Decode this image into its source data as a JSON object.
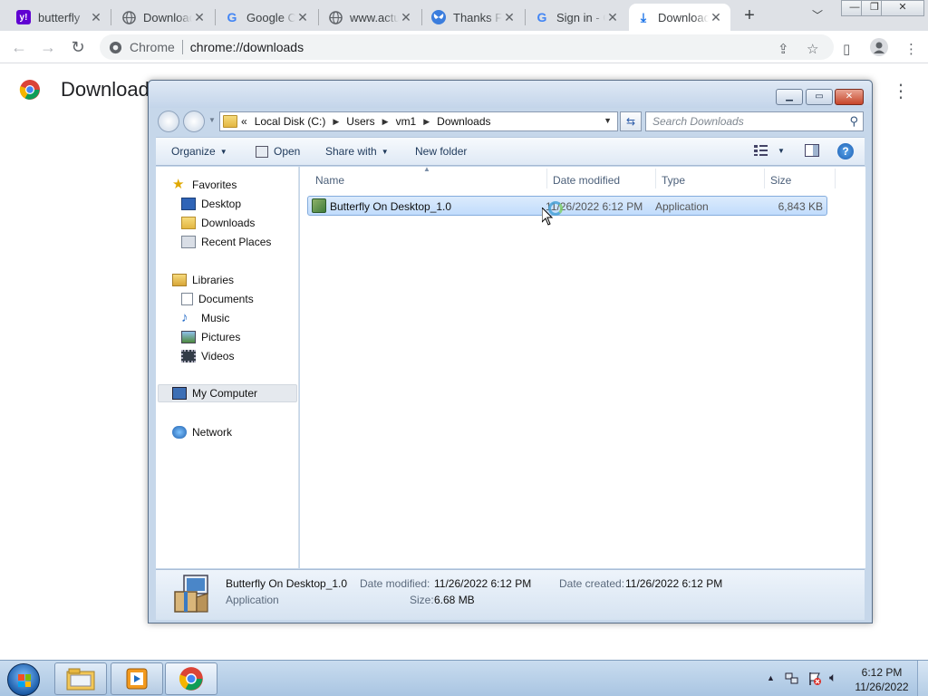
{
  "browser": {
    "tabs": [
      {
        "label": "butterfly",
        "favicon": "yahoo-icon",
        "active": false
      },
      {
        "label": "Downloads",
        "favicon": "globe-icon",
        "active": false
      },
      {
        "label": "Google Chrome",
        "favicon": "google-icon",
        "active": false
      },
      {
        "label": "www.actualsolution",
        "favicon": "globe-icon",
        "active": false
      },
      {
        "label": "Thanks For Downloading",
        "favicon": "butterfly-icon",
        "active": false
      },
      {
        "label": "Sign in - Google",
        "favicon": "google-icon",
        "active": false
      },
      {
        "label": "Downloads",
        "favicon": "download-icon",
        "active": true
      }
    ],
    "window_controls": {
      "minimize": "—",
      "restore": "❐",
      "close": "✕"
    },
    "omnibox": {
      "chip": "Chrome",
      "url": "chrome://downloads"
    },
    "page_title": "Downloads"
  },
  "explorer": {
    "address": {
      "prefix": "«",
      "crumbs": [
        "Local Disk (C:)",
        "Users",
        "vm1",
        "Downloads"
      ]
    },
    "search_placeholder": "Search Downloads",
    "commands": {
      "organize": "Organize",
      "open": "Open",
      "share_with": "Share with",
      "new_folder": "New folder"
    },
    "nav": {
      "favorites": "Favorites",
      "desktop": "Desktop",
      "downloads": "Downloads",
      "recent_places": "Recent Places",
      "libraries": "Libraries",
      "documents": "Documents",
      "music": "Music",
      "pictures": "Pictures",
      "videos": "Videos",
      "my_computer": "My Computer",
      "network": "Network"
    },
    "columns": {
      "name": "Name",
      "date_modified": "Date modified",
      "type": "Type",
      "size": "Size"
    },
    "files": [
      {
        "name": "Butterfly On Desktop_1.0",
        "date_modified": "11/26/2022 6:12 PM",
        "type": "Application",
        "size": "6,843 KB"
      }
    ],
    "details": {
      "name": "Butterfly On Desktop_1.0",
      "type": "Application",
      "date_modified_label": "Date modified:",
      "date_modified": "11/26/2022 6:12 PM",
      "date_created_label": "Date created:",
      "date_created": "11/26/2022 6:12 PM",
      "size_label": "Size:",
      "size": "6.68 MB"
    }
  },
  "taskbar": {
    "time": "6:12 PM",
    "date": "11/26/2022"
  },
  "colors": {
    "chrome_tabstrip": "#dee1e6",
    "win7_taskbar": "#a9c5e2",
    "selection": "#c1dcfc"
  }
}
